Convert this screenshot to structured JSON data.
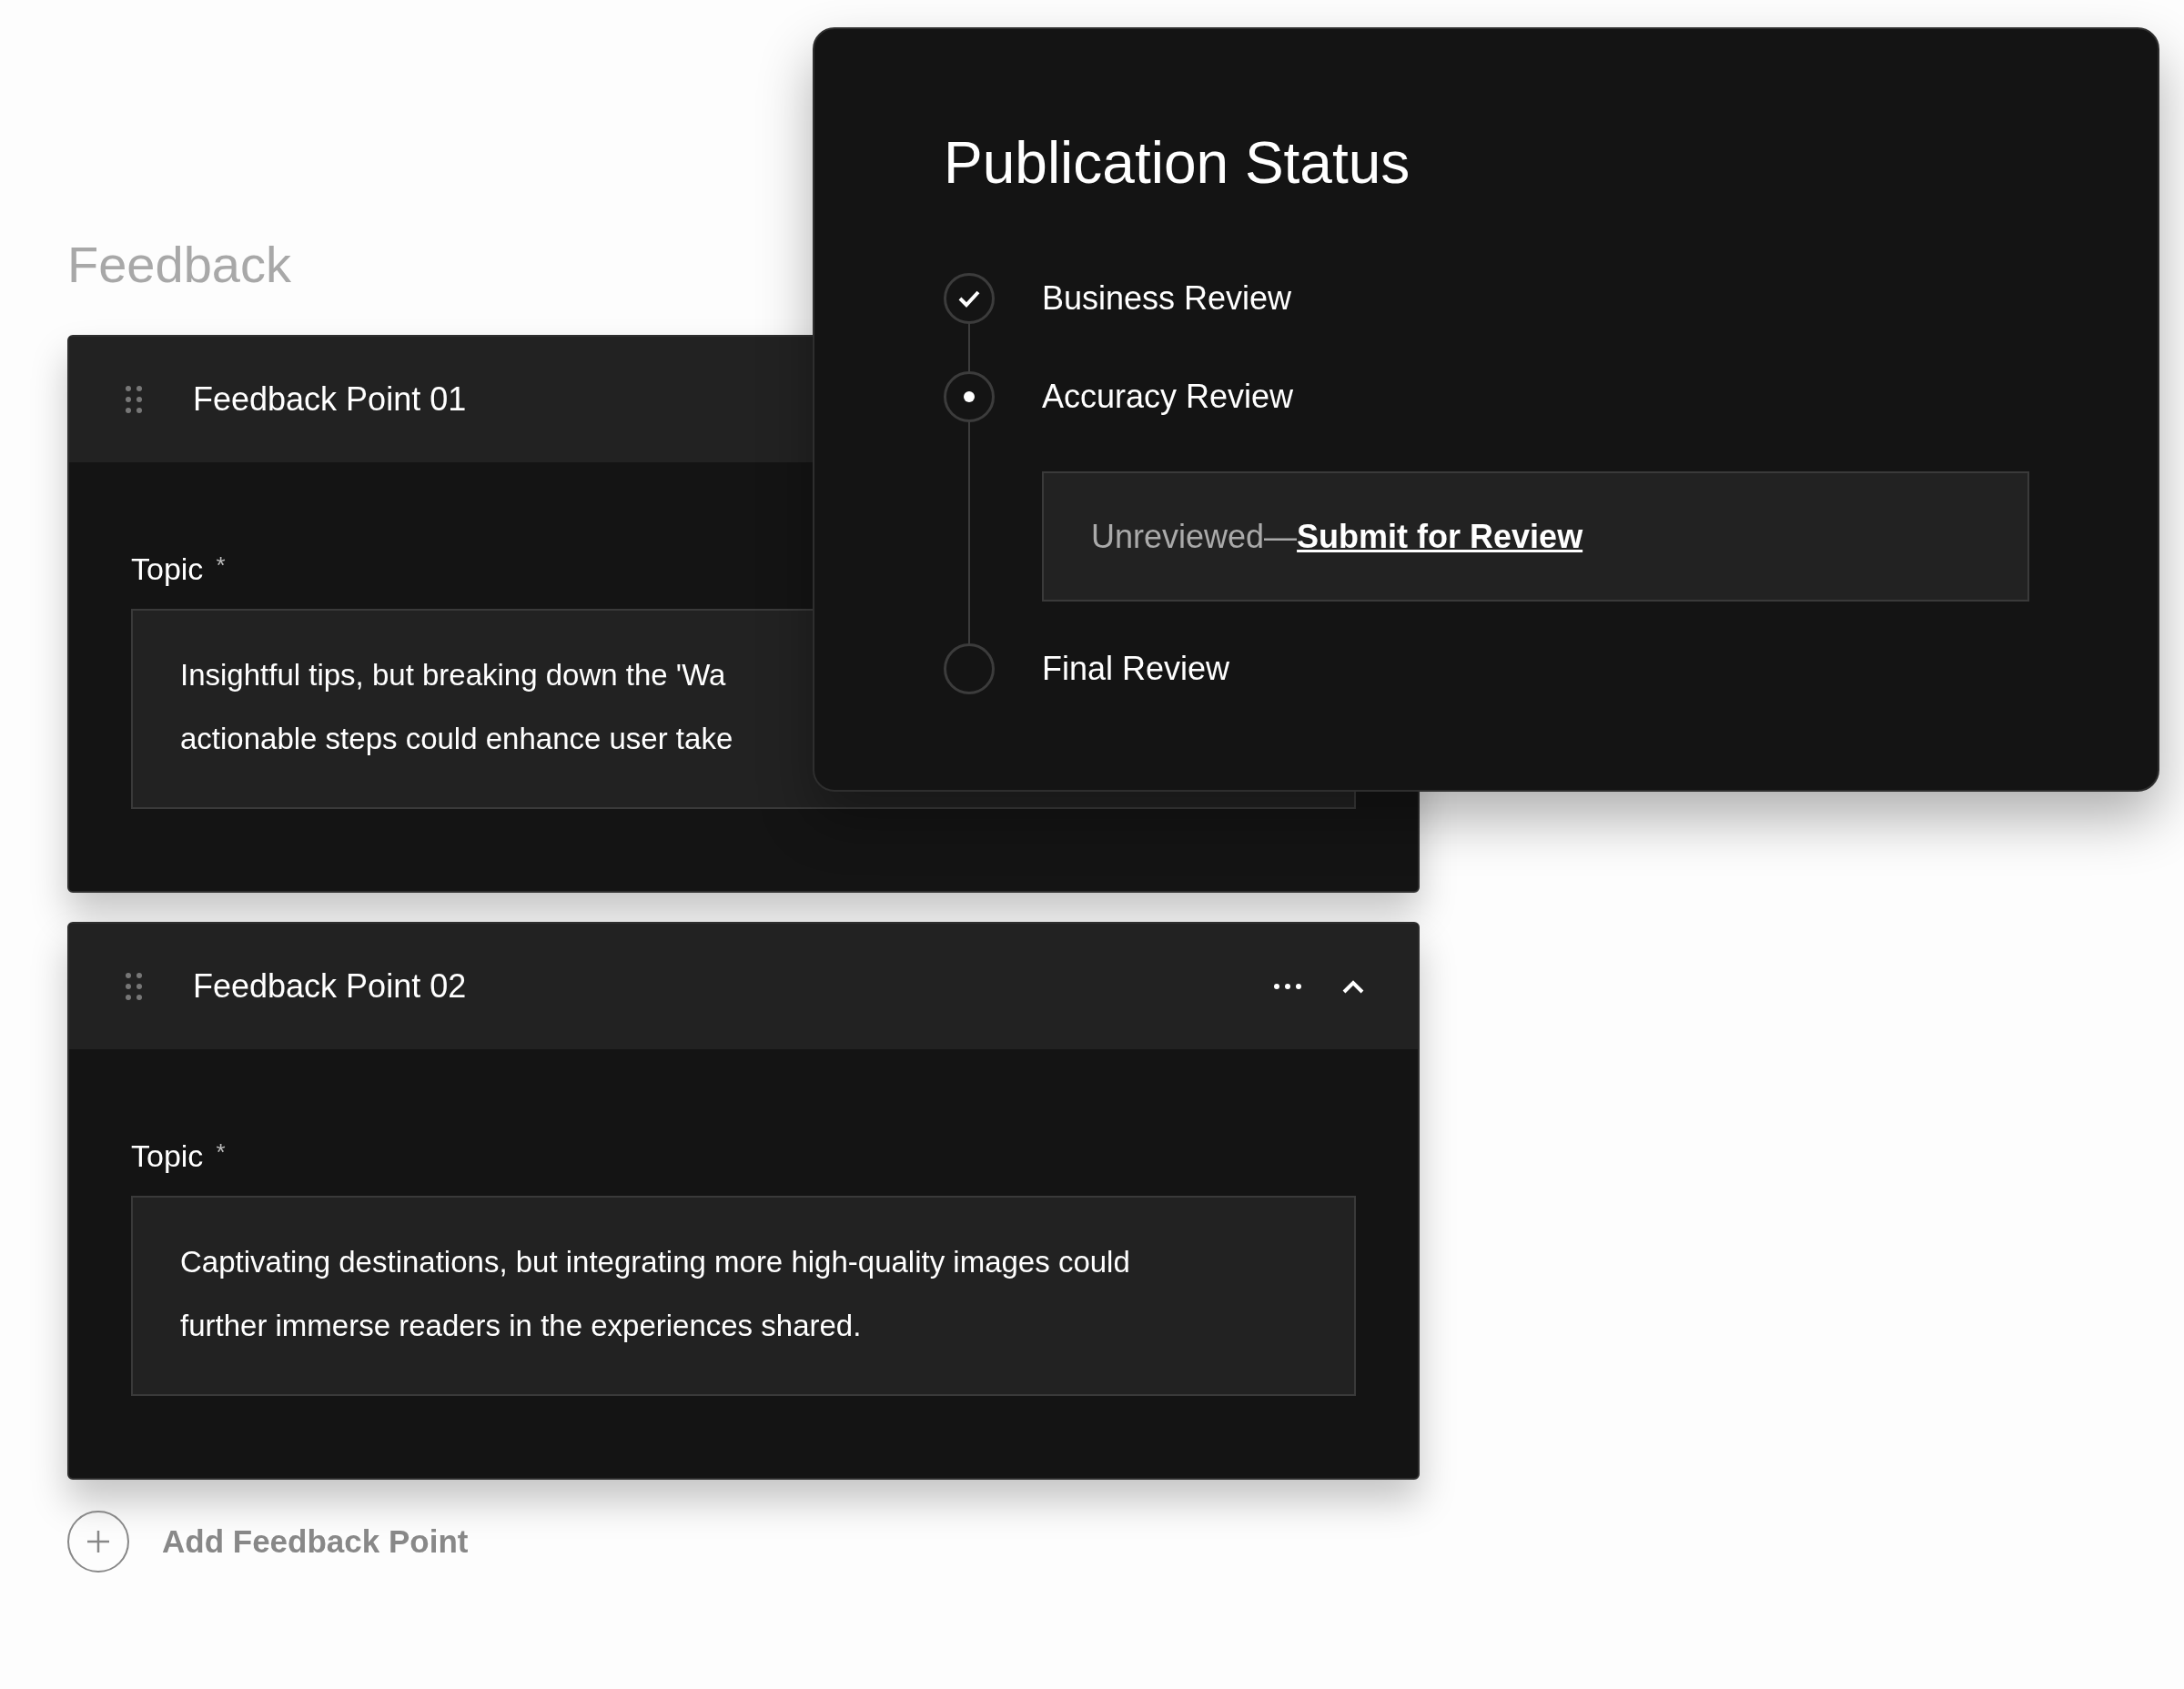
{
  "heading": "Feedback",
  "feedback_points": [
    {
      "title": "Feedback Point 01",
      "topic_label": "Topic",
      "required_mark": "*",
      "answer_lines": [
        "Insightful tips, but breaking down the 'Wa",
        "actionable steps could enhance user take"
      ],
      "show_actions": false,
      "expanded": true
    },
    {
      "title": "Feedback Point 02",
      "topic_label": "Topic",
      "required_mark": "*",
      "answer_lines": [
        "Captivating destinations, but integrating more high-quality images could",
        "further immerse readers in the experiences shared."
      ],
      "show_actions": true,
      "expanded": true
    }
  ],
  "add_button": {
    "label": "Add Feedback Point"
  },
  "publication_status": {
    "title": "Publication Status",
    "steps": [
      {
        "label": "Business Review",
        "kind": "done"
      },
      {
        "label": "Accuracy Review",
        "kind": "current",
        "note": {
          "text": "Unreviewed—",
          "link": "Submit for Review"
        }
      },
      {
        "label": "Final Review",
        "kind": "pending"
      }
    ]
  }
}
